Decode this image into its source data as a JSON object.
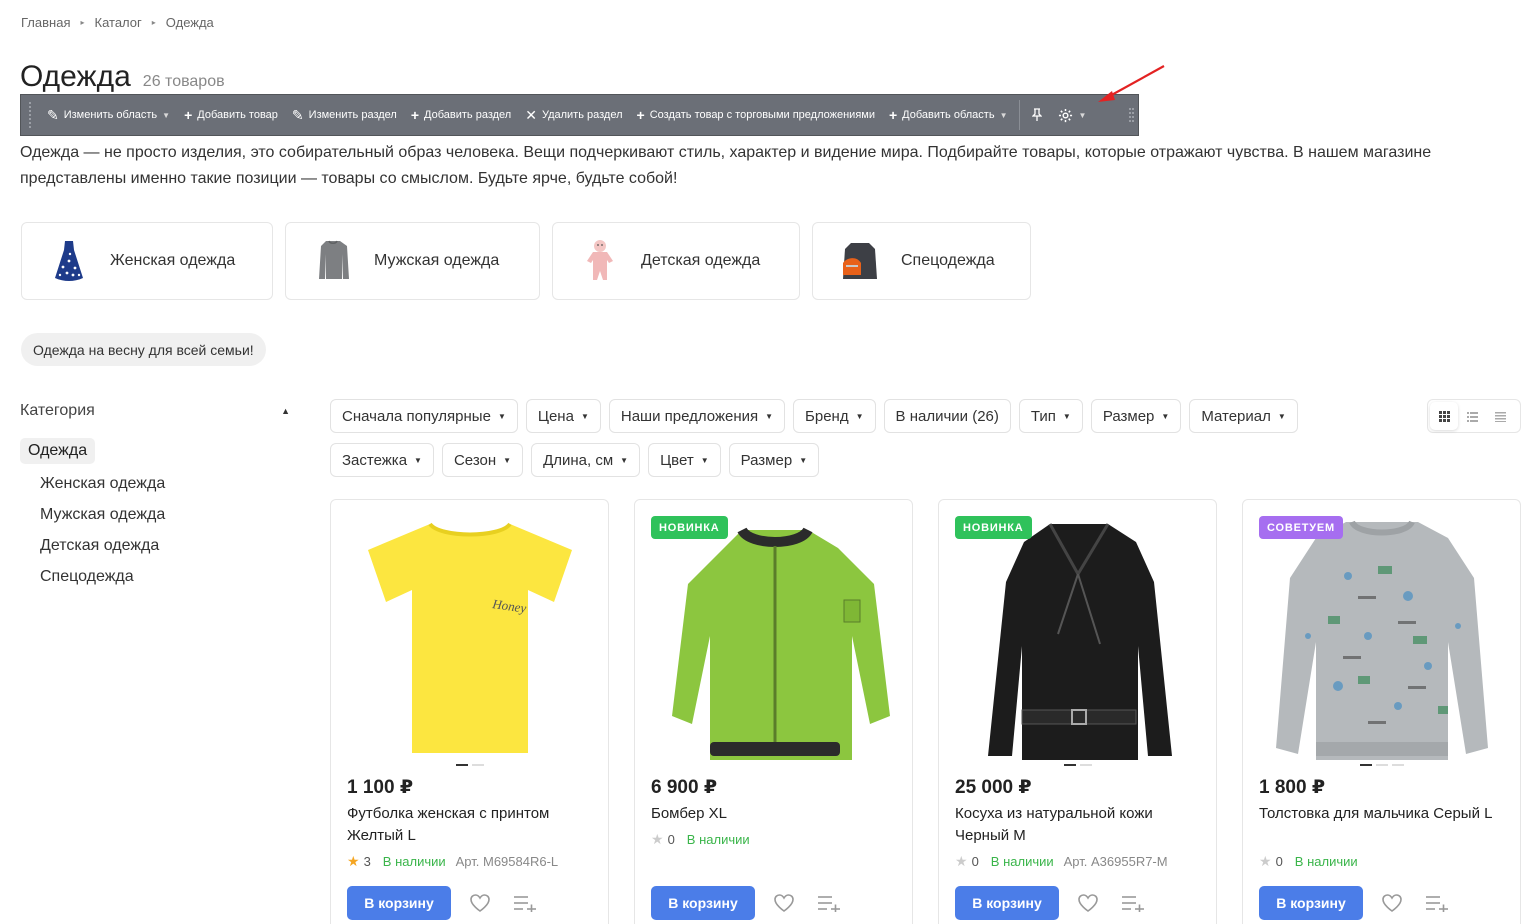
{
  "breadcrumb": [
    "Главная",
    "Каталог",
    "Одежда"
  ],
  "title": "Одежда",
  "count": "26 товаров",
  "toolbar": {
    "buttons": [
      {
        "label": "Изменить область",
        "icon": "pencil-icon",
        "caret": true
      },
      {
        "label": "Добавить товар",
        "icon": "plus-icon"
      },
      {
        "label": "Изменить раздел",
        "icon": "pencil-icon"
      },
      {
        "label": "Добавить раздел",
        "icon": "plus-icon"
      },
      {
        "label": "Удалить раздел",
        "icon": "x-icon"
      },
      {
        "label": "Создать товар с торговыми предложениями",
        "icon": "plus-icon"
      },
      {
        "label": "Добавить область",
        "icon": "plus-icon",
        "caret": true
      }
    ],
    "icons": [
      "pin-icon",
      "gear-icon"
    ]
  },
  "description": "Одежда — не просто изделия, это собирательный образ человека. Вещи подчеркивают стиль, характер и видение мира. Подбирайте товары, которые отражают чувства. В нашем магазине представлены именно такие позиции — товары со смыслом. Будьте ярче, будьте собой!",
  "categories": [
    {
      "label": "Женская одежда",
      "icon": "dress-icon"
    },
    {
      "label": "Мужская одежда",
      "icon": "sweater-icon"
    },
    {
      "label": "Детская одежда",
      "icon": "baby-bodysuit-icon"
    },
    {
      "label": "Спецодежда",
      "icon": "workwear-icon"
    }
  ],
  "promo": "Одежда на весну для всей семьи!",
  "sidebar": {
    "heading": "Категория",
    "active": "Одежда",
    "items": [
      "Женская одежда",
      "Мужская одежда",
      "Детская одежда",
      "Спецодежда"
    ]
  },
  "filters": [
    "Сначала популярные",
    "Цена",
    "Наши предложения",
    "Бренд",
    "В наличии (26)",
    "Тип",
    "Размер",
    "Материал",
    "Застежка",
    "Сезон",
    "Длина, см",
    "Цвет",
    "Размер"
  ],
  "view_modes": [
    "grid-view-icon",
    "list-view-icon",
    "table-view-icon"
  ],
  "colors": {
    "accent": "#4b7de8",
    "stock": "#3ab54a",
    "badge_new": "#2fc25b",
    "badge_recommend": "#a66ef0",
    "toolbar": "#6b6f77"
  },
  "products": [
    {
      "price": "1 100 ₽",
      "name": "Футболка женская с принтом Желтый L",
      "rating": "3",
      "stock": "В наличии",
      "article": "Арт. M69584R6-L",
      "badge": "",
      "cart": "В корзину",
      "slides": 2,
      "active_slide": 1,
      "rated": true
    },
    {
      "price": "6 900 ₽",
      "name": "Бомбер XL",
      "rating": "0",
      "stock": "В наличии",
      "article": "",
      "badge": "НОВИНКА",
      "badge_color": "#2fc25b",
      "cart": "В корзину",
      "slides": 0,
      "active_slide": 0,
      "rated": false
    },
    {
      "price": "25 000 ₽",
      "name": "Косуха из натуральной кожи Черный M",
      "rating": "0",
      "stock": "В наличии",
      "article": "Арт. A36955R7-M",
      "badge": "НОВИНКА",
      "badge_color": "#2fc25b",
      "cart": "В корзину",
      "slides": 2,
      "active_slide": 1,
      "rated": false
    },
    {
      "price": "1 800 ₽",
      "name": "Толстовка для мальчика Серый L",
      "rating": "0",
      "stock": "В наличии",
      "article": "",
      "badge": "СОВЕТУЕМ",
      "badge_color": "#a66ef0",
      "cart": "В корзину",
      "slides": 3,
      "active_slide": 1,
      "rated": false
    }
  ]
}
